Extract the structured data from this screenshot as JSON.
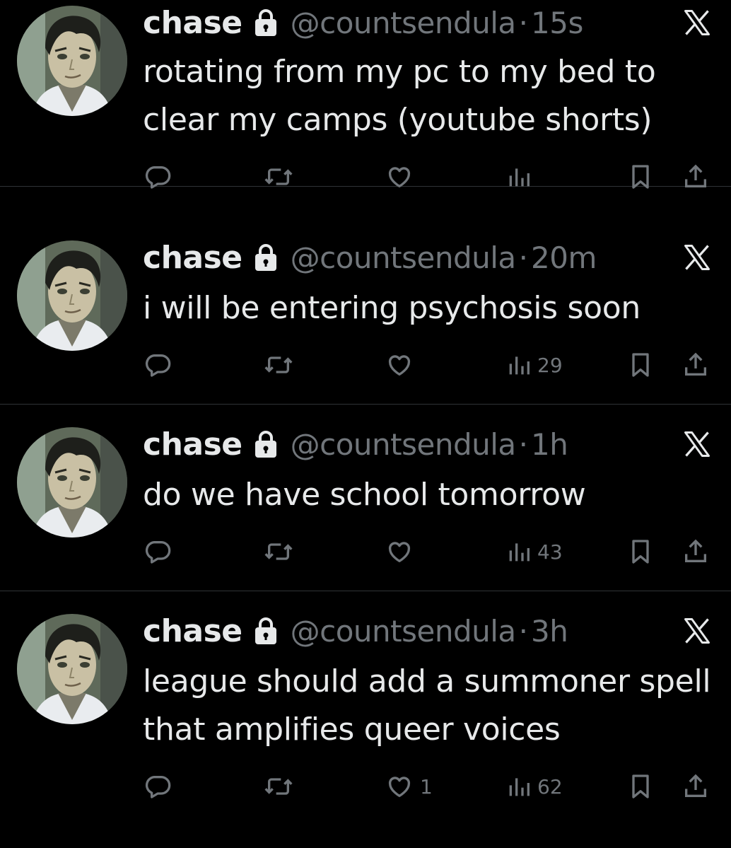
{
  "tweets": [
    {
      "name": "chase",
      "handle": "@countsendula",
      "separator": "·",
      "time": "15s",
      "text": "rotating from my pc to my bed to clear my camps (youtube shorts)",
      "likes": "",
      "views": ""
    },
    {
      "name": "chase",
      "handle": "@countsendula",
      "separator": "·",
      "time": "20m",
      "text": "i will be entering psychosis soon",
      "likes": "",
      "views": "29"
    },
    {
      "name": "chase",
      "handle": "@countsendula",
      "separator": "·",
      "time": "1h",
      "text": "do we have school tomorrow",
      "likes": "",
      "views": "43"
    },
    {
      "name": "chase",
      "handle": "@countsendula",
      "separator": "·",
      "time": "3h",
      "text": "league should add a summoner spell that amplifies queer voices",
      "likes": "1",
      "views": "62"
    }
  ],
  "icons": {
    "lock": "lock-icon",
    "platform": "x-logo-icon",
    "reply": "reply-icon",
    "repost": "repost-icon",
    "like": "like-icon",
    "views": "views-icon",
    "bookmark": "bookmark-icon",
    "share": "share-icon"
  },
  "colors": {
    "background": "#000000",
    "primary_text": "#e7e9ea",
    "secondary_text": "#71767b",
    "divider": "#2f3336"
  }
}
